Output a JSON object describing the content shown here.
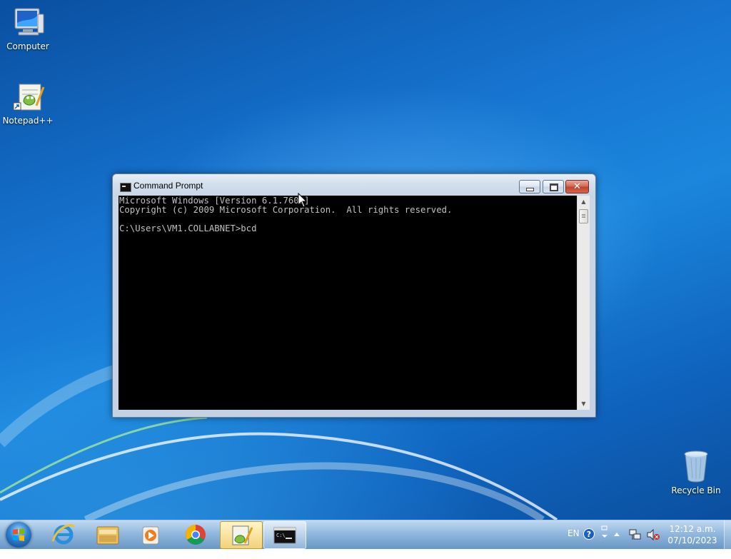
{
  "desktop": {
    "icons": [
      {
        "label": "Computer"
      },
      {
        "label": "Notepad++"
      },
      {
        "label": "Recycle Bin"
      }
    ]
  },
  "window": {
    "title": "Command Prompt",
    "console_lines": [
      "Microsoft Windows [Version 6.1.7601]",
      "Copyright (c) 2009 Microsoft Corporation.  All rights reserved.",
      "",
      "C:\\Users\\VM1.COLLABNET>bcd"
    ]
  },
  "taskbar": {
    "language": "EN",
    "time": "12:12 a.m.",
    "date": "07/10/2023",
    "apps": [
      {
        "icon": "internet-explorer-icon"
      },
      {
        "icon": "file-explorer-icon"
      },
      {
        "icon": "media-player-icon"
      },
      {
        "icon": "chrome-icon"
      },
      {
        "icon": "notepad-plus-plus-icon"
      },
      {
        "icon": "command-prompt-icon"
      }
    ]
  }
}
